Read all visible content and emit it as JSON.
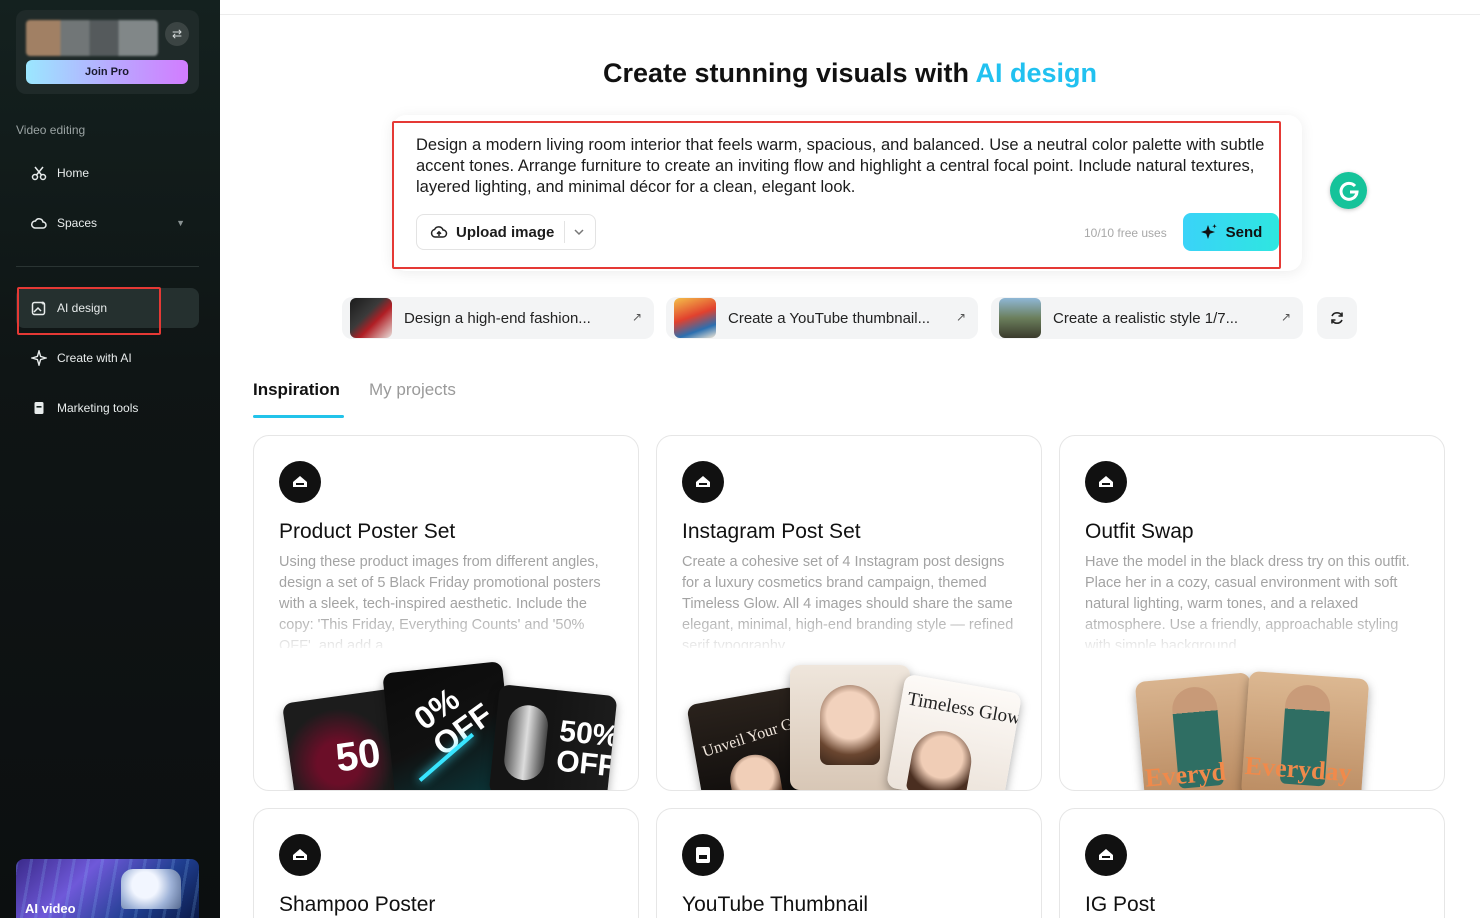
{
  "sidebar": {
    "join_pro": "Join Pro",
    "section_label": "Video editing",
    "items": [
      {
        "label": "Home",
        "icon": "scissors-icon"
      },
      {
        "label": "Spaces",
        "icon": "cloud-icon"
      },
      {
        "label": "AI design",
        "icon": "image-edit-icon"
      },
      {
        "label": "Create with AI",
        "icon": "sparkle-icon"
      },
      {
        "label": "Marketing tools",
        "icon": "bag-icon"
      }
    ],
    "promo_label": "AI video"
  },
  "main": {
    "title_prefix": "Create stunning visuals with ",
    "title_accent": "AI design",
    "accent_color": "#21c1f0",
    "prompt": "Design a modern living room interior that feels warm, spacious, and balanced. Use a neutral color palette with subtle accent tones. Arrange furniture to create an inviting flow and highlight a central focal point. Include natural textures, layered lighting, and minimal décor for a clean, elegant look.",
    "upload_label": "Upload image",
    "free_uses": "10/10 free uses",
    "send_label": "Send",
    "suggestions": [
      {
        "label": "Design a high-end fashion..."
      },
      {
        "label": "Create a YouTube thumbnail..."
      },
      {
        "label": "Create a realistic style 1/7..."
      }
    ],
    "tabs": [
      {
        "label": "Inspiration",
        "active": true
      },
      {
        "label": "My projects",
        "active": false
      }
    ],
    "cards": [
      {
        "title": "Product Poster Set",
        "desc": "Using these product images from different angles, design a set of 5 Black Friday promotional posters with a sleek, tech-inspired aesthetic. Include the copy: 'This Friday, Everything Counts' and '50% OFF', and add a"
      },
      {
        "title": "Instagram Post Set",
        "desc": "Create a cohesive set of 4 Instagram post designs for a luxury cosmetics brand campaign, themed Timeless Glow. All 4 images should share the same elegant, minimal, high-end branding style — refined serif typography"
      },
      {
        "title": "Outfit Swap",
        "desc": "Have the model in the black dress try on this outfit. Place her in a cozy, casual environment with soft natural lighting, warm tones, and a relaxed atmosphere. Use a friendly, approachable styling with simple background"
      },
      {
        "title": "Shampoo Poster",
        "desc": ""
      },
      {
        "title": "YouTube Thumbnail",
        "desc": ""
      },
      {
        "title": "IG Post",
        "desc": ""
      }
    ],
    "poster_text": {
      "p1a": "50",
      "p1b": "0%",
      "p1c": "OFF",
      "p1d": "50%",
      "p1e": "OFF",
      "p2a": "Unveil Your Gl",
      "p2b": "Timeless Glow",
      "p3a": "Everyd",
      "p3b": "Everyday"
    }
  }
}
